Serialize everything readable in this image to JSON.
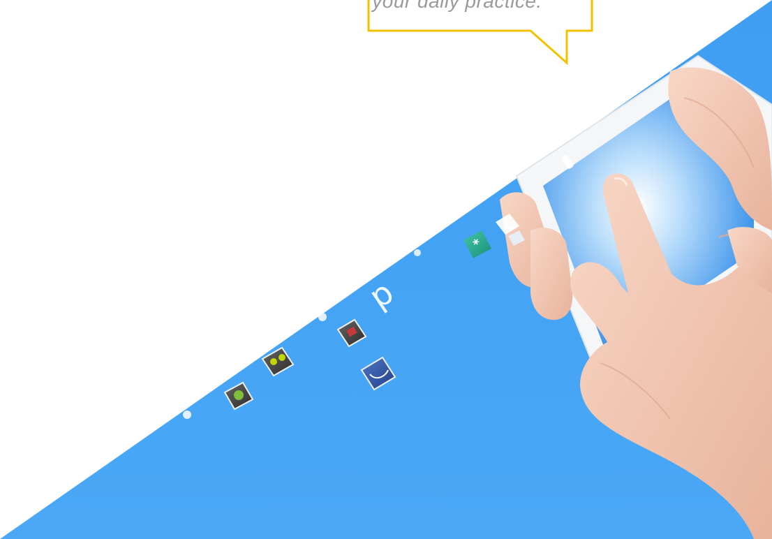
{
  "callout": {
    "text": "your daily practice."
  },
  "colors": {
    "callout_border": "#f2c200",
    "callout_text": "#9a9a9a",
    "background_top": "#ffffff",
    "background_bottom": "#4aa8f7",
    "skin": "#f3c9b6"
  },
  "icons": [
    "star-app-icon",
    "link-app-icon",
    "photo-app-icon",
    "letter-p-glyph",
    "android-app-icon",
    "game-app-icon"
  ]
}
